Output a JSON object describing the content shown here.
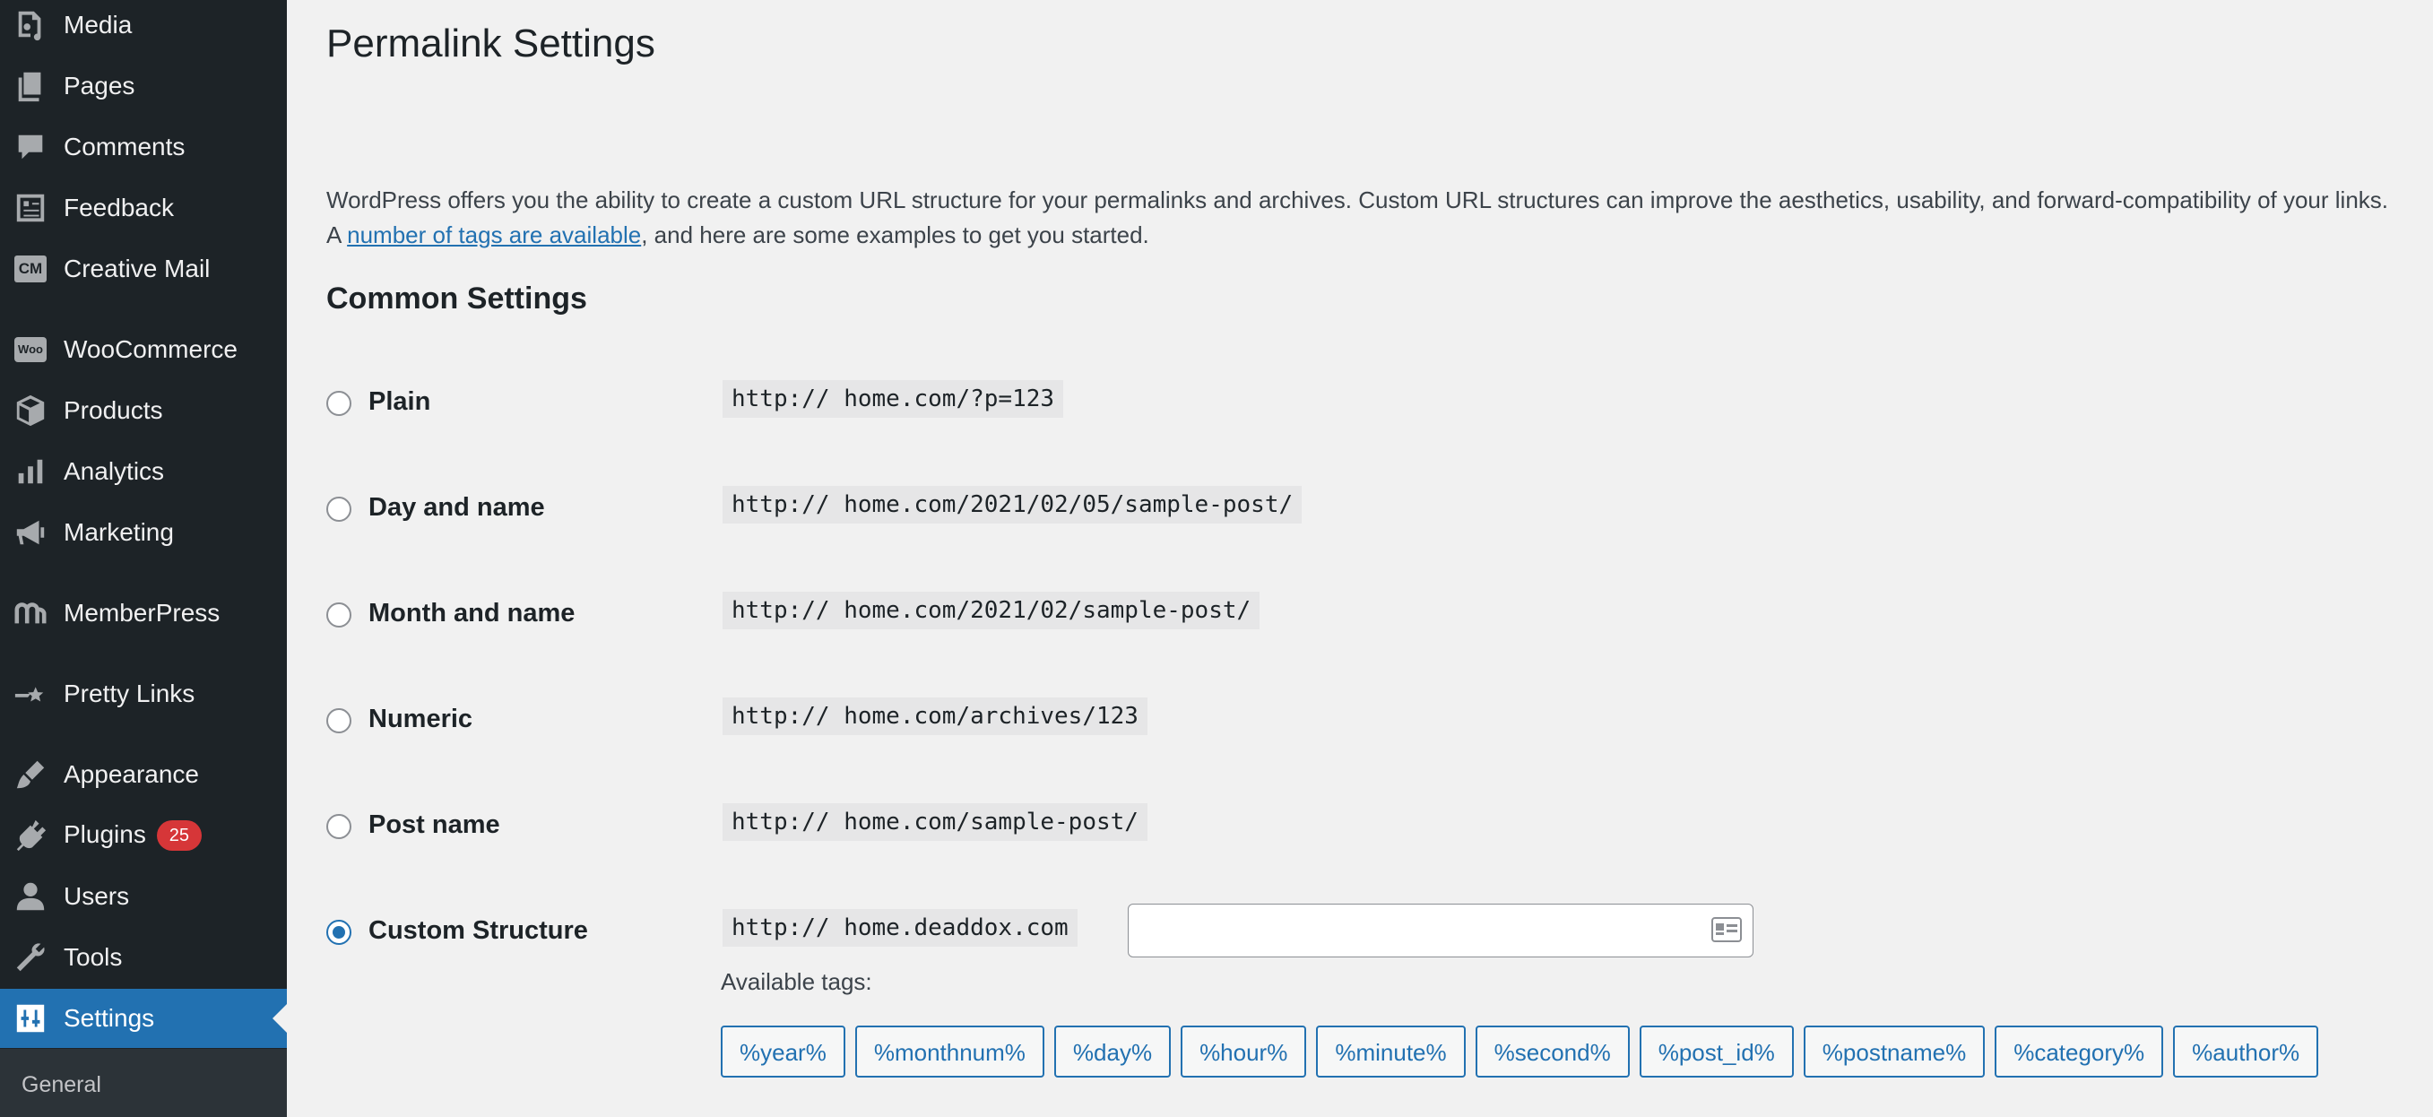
{
  "sidebar": {
    "items": [
      {
        "label": "Media",
        "icon": "media-icon"
      },
      {
        "label": "Pages",
        "icon": "pages-icon"
      },
      {
        "label": "Comments",
        "icon": "comments-icon"
      },
      {
        "label": "Feedback",
        "icon": "feedback-icon"
      },
      {
        "label": "Creative Mail",
        "icon": "creative-mail-icon",
        "icon_text": "CM"
      },
      {
        "label": "WooCommerce",
        "icon": "woocommerce-icon",
        "icon_text": "Woo"
      },
      {
        "label": "Products",
        "icon": "products-icon"
      },
      {
        "label": "Analytics",
        "icon": "analytics-icon"
      },
      {
        "label": "Marketing",
        "icon": "marketing-icon"
      },
      {
        "label": "MemberPress",
        "icon": "memberpress-icon"
      },
      {
        "label": "Pretty Links",
        "icon": "pretty-links-icon"
      },
      {
        "label": "Appearance",
        "icon": "appearance-icon"
      },
      {
        "label": "Plugins",
        "icon": "plugins-icon",
        "badge": "25"
      },
      {
        "label": "Users",
        "icon": "users-icon"
      },
      {
        "label": "Tools",
        "icon": "tools-icon"
      },
      {
        "label": "Settings",
        "icon": "settings-icon",
        "active": true
      }
    ],
    "submenu": {
      "label": "General"
    }
  },
  "page": {
    "title": "Permalink Settings",
    "intro_before_link": "WordPress offers you the ability to create a custom URL structure for your permalinks and archives. Custom URL structures can improve the aesthetics, usability, and forward-compatibility of your links. A ",
    "intro_link": "number of tags are available",
    "intro_after_link": ", and here are some examples to get you started.",
    "section_title": "Common Settings"
  },
  "options": [
    {
      "label": "Plain",
      "example": "http:// home.com/?p=123",
      "checked": false
    },
    {
      "label": "Day and name",
      "example": "http:// home.com/2021/02/05/sample-post/",
      "checked": false
    },
    {
      "label": "Month and name",
      "example": "http:// home.com/2021/02/sample-post/",
      "checked": false
    },
    {
      "label": "Numeric",
      "example": "http:// home.com/archives/123",
      "checked": false
    },
    {
      "label": "Post name",
      "example": "http:// home.com/sample-post/",
      "checked": false
    },
    {
      "label": "Custom Structure",
      "example": "http:// home.deaddox.com",
      "checked": true
    }
  ],
  "custom_structure": {
    "value": "",
    "available_tags_label": "Available tags:",
    "tags": [
      "%year%",
      "%monthnum%",
      "%day%",
      "%hour%",
      "%minute%",
      "%second%",
      "%post_id%",
      "%postname%",
      "%category%",
      "%author%"
    ]
  },
  "colors": {
    "sidebar_bg": "#1d2327",
    "accent": "#2271b1",
    "badge": "#d63638",
    "page_bg": "#f1f1f1"
  }
}
